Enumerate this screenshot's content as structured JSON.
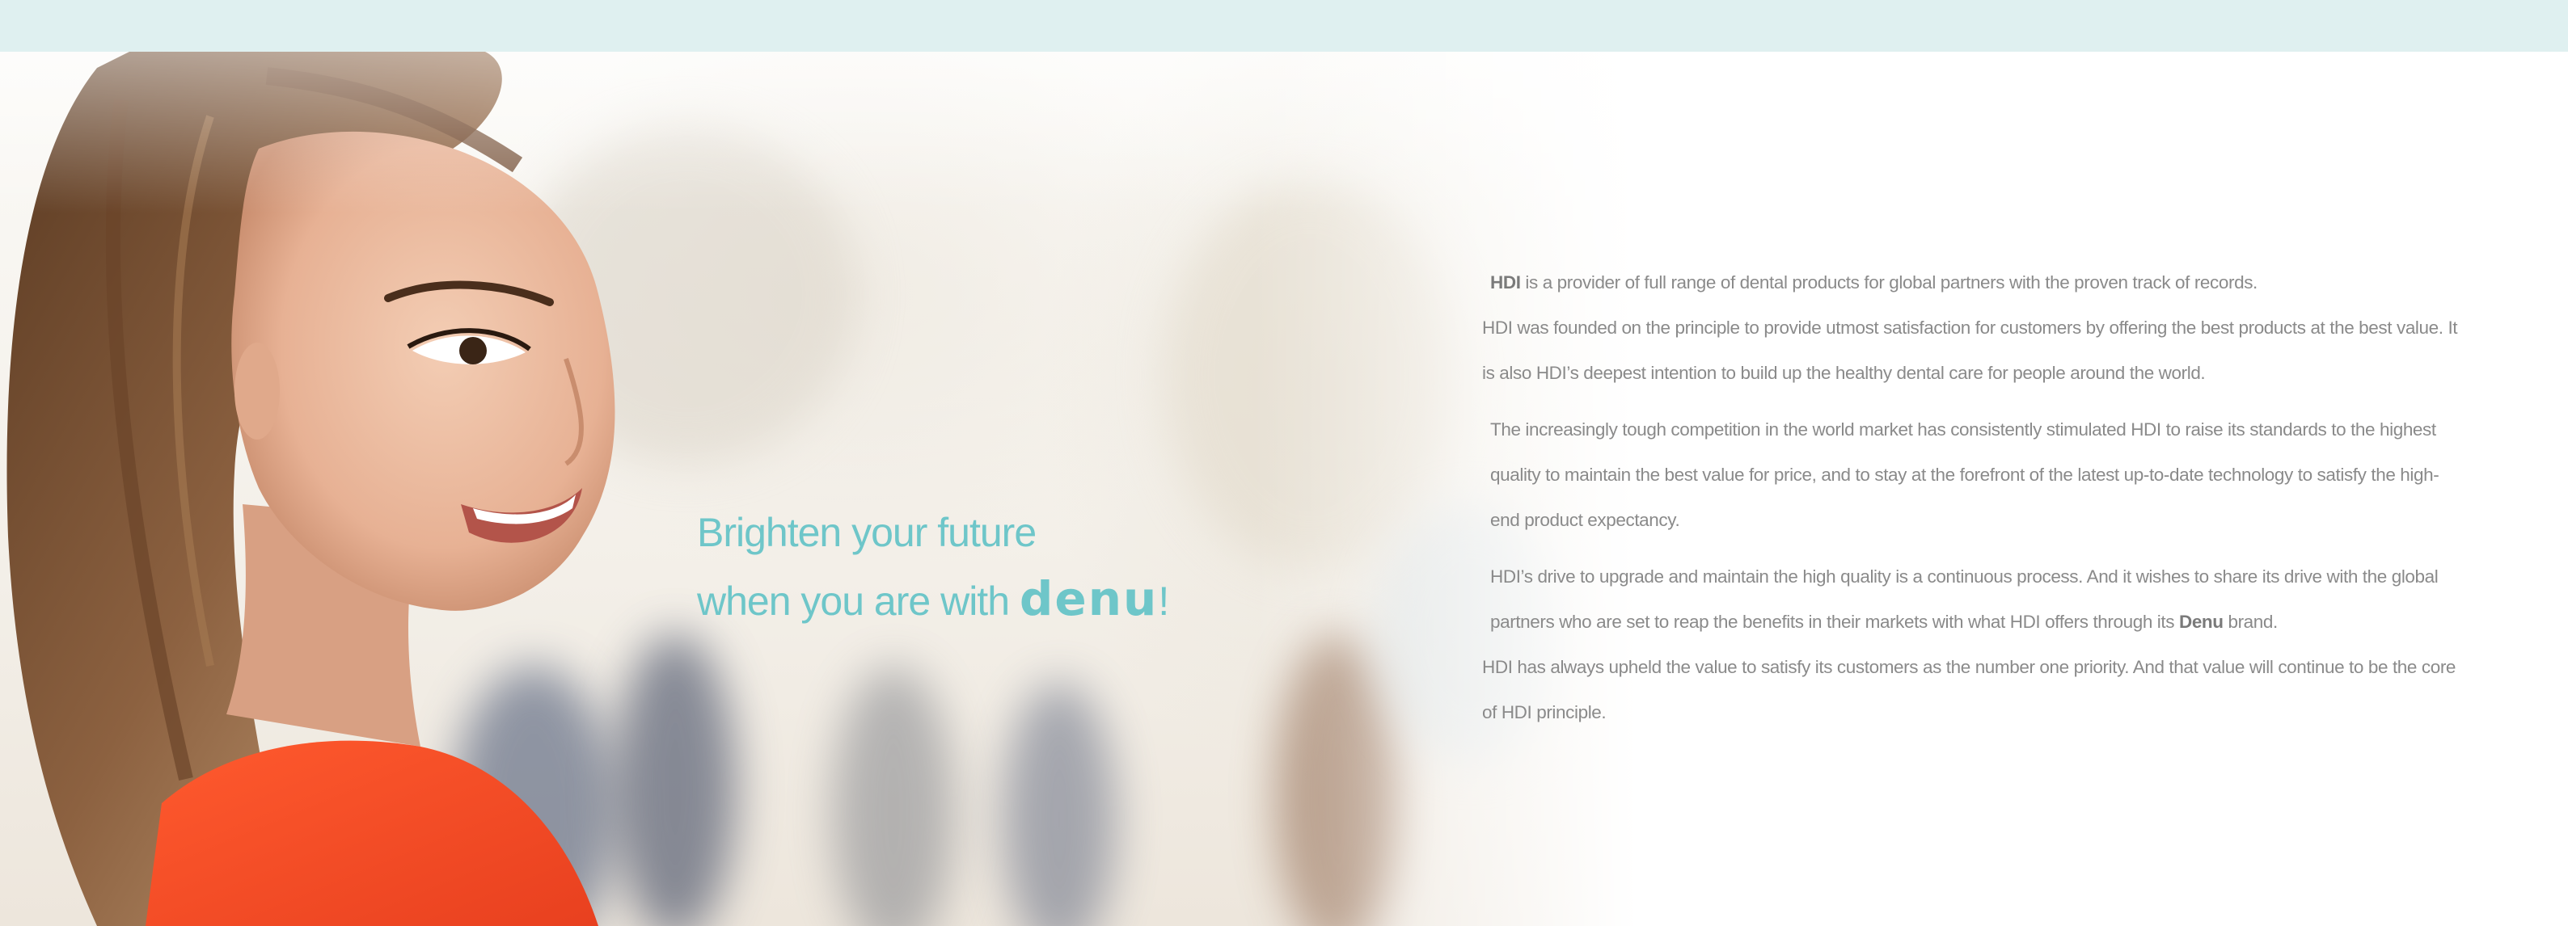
{
  "colors": {
    "top_bar": "#dff0f0",
    "accent": "#6ec6c9",
    "body_text": "#8a8a8a"
  },
  "hero": {
    "tagline_line1": "Brighten your future",
    "tagline_line2_prefix": "when you are with ",
    "tagline_brand": "denu",
    "tagline_suffix": "!"
  },
  "intro": {
    "p1_bold": "HDI",
    "p1_rest": " is a provider of full range of dental products for global partners with the proven track of records.",
    "p2": "HDI was founded on the principle to provide utmost satisfaction for customers by offering the best products at the best value. It is also HDI’s deepest intention to build up the healthy dental care for people around the world.",
    "p3": "The increasingly tough competition in the world market has consistently stimulated HDI to raise its standards to the highest quality to maintain the best value for price, and to stay at the forefront of the latest up-to-date technology to satisfy the high-end product expectancy.",
    "p4_start": "HDI’s drive to upgrade and maintain the high quality is a continuous process. And it wishes to share its drive with the global partners who are set to reap the benefits in their markets with what HDI offers through its ",
    "p4_bold": "Denu",
    "p4_end": " brand.",
    "p5": "HDI has always upheld the value to satisfy its customers as the number one priority. And that value will continue to be the core of HDI principle."
  }
}
